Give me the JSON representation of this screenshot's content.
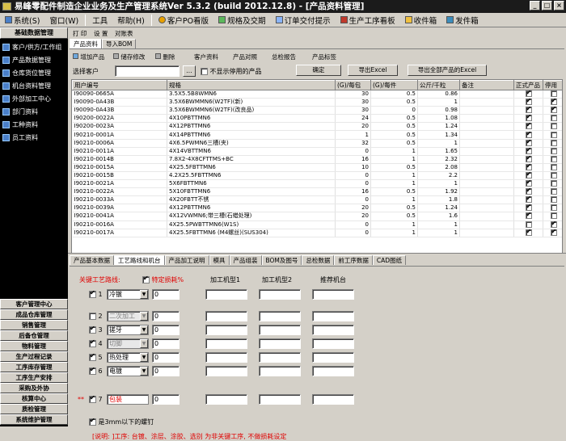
{
  "window": {
    "title": "易峰零配件制造企业业务及生产管理系统Ver 5.3.2  (build 2012.12.8)  - [产品资料管理]"
  },
  "menubar": [
    {
      "label": "系统(S)",
      "icon": "system-icon"
    },
    {
      "label": "窗口(W)",
      "icon": ""
    },
    {
      "label": "工具",
      "icon": ""
    },
    {
      "label": "帮助(H)",
      "icon": ""
    },
    {
      "label": "客户PO看版",
      "icon": "po-board-icon"
    },
    {
      "label": "规格及交期",
      "icon": "spec-icon"
    },
    {
      "label": "订单交付提示",
      "icon": "delivery-icon"
    },
    {
      "label": "生产工序看板",
      "icon": "process-board-icon"
    },
    {
      "label": "收件箱",
      "icon": "inbox-icon"
    },
    {
      "label": "发件箱",
      "icon": "outbox-icon"
    }
  ],
  "sidebar": {
    "header": "基础数据管理",
    "items": [
      "客户/供方/工作组",
      "产品数据管理",
      "仓库货位管理",
      "机台资料管理",
      "外部加工中心",
      "部门资料",
      "工种资料",
      "员工资料"
    ],
    "bottom": [
      "客户管理中心",
      "成品仓库管理",
      "销售管理",
      "后备仓管理",
      "物料管理",
      "生产过程记录",
      "工序库存管理",
      "工序生产安排",
      "采购及外协",
      "核算中心",
      "质检管理",
      "系统维护管理"
    ]
  },
  "toolbar_top": [
    "打 印",
    "设 置",
    "对账表"
  ],
  "tabs_top": [
    "产品资料",
    "导入BOM"
  ],
  "actions": [
    "增加产品",
    "储存修改",
    "删除",
    "客户资料",
    "产品对照",
    "总检报告",
    "产品标签"
  ],
  "filter": {
    "label": "选择客户",
    "value": "",
    "browse": "...",
    "hide_disabled_label": "不显示停用的产品",
    "confirm": "确定",
    "export": "导出Excel",
    "export_all": "导出全部产品的Excel"
  },
  "grid": {
    "columns": [
      "用户编号",
      "规格",
      "(G)/每包",
      "(G)/每件",
      "公斤/千粒",
      "备注",
      "正式产品",
      "停用"
    ],
    "rows": [
      [
        "I90090-0665A",
        "3.5X5.5B8WMN6",
        "30",
        "0.5",
        "0.86",
        "",
        true,
        false
      ],
      [
        "I90090-0A43B",
        "3.5X6BWMMN6(W2TF)(新)",
        "30",
        "0.5",
        "1",
        "",
        true,
        true
      ],
      [
        "I90090-0A43B",
        "3.5X6BWMMN6(W2TF)(改良品)",
        "30",
        "0",
        "0.98",
        "",
        true,
        true
      ],
      [
        "I90200-0022A",
        "4X10PBTTMN6",
        "24",
        "0.5",
        "1.08",
        "",
        true,
        false
      ],
      [
        "I90200-0023A",
        "4X12PBTTMN6",
        "20",
        "0.5",
        "1.24",
        "",
        true,
        false
      ],
      [
        "I90210-0001A",
        "4X14PBTTMN6",
        "1",
        "0.5",
        "1.34",
        "",
        true,
        false
      ],
      [
        "I90210-0006A",
        "4X6.5PWMN6三槽(夹)",
        "32",
        "0.5",
        "1",
        "",
        true,
        false
      ],
      [
        "I90210-0011A",
        "4X14VBTTMN6",
        "0",
        "1",
        "1.65",
        "",
        true,
        false
      ],
      [
        "I90210-0014B",
        "7.8X2-4X8CFTTMS+BC",
        "16",
        "1",
        "2.32",
        "",
        true,
        false
      ],
      [
        "I90210-0015A",
        "4X25.5FBTTMN6",
        "10",
        "0.5",
        "2.08",
        "",
        true,
        false
      ],
      [
        "I90210-0015B",
        "4.2X25.5FBTTMN6",
        "0",
        "1",
        "2.2",
        "",
        true,
        false
      ],
      [
        "I90210-0021A",
        "5X6FBTTMN6",
        "0",
        "1",
        "1",
        "",
        true,
        false
      ],
      [
        "I90210-0022A",
        "5X10FBTTMN6",
        "16",
        "0.5",
        "1.92",
        "",
        true,
        false
      ],
      [
        "I90210-0033A",
        "4X20FBTT不锈",
        "0",
        "1",
        "1.8",
        "",
        true,
        false
      ],
      [
        "I90210-0039A",
        "4X12PBTTMN6",
        "20",
        "0.5",
        "1.24",
        "",
        true,
        false
      ],
      [
        "I90210-0041A",
        "4X12VWMN6;带三槽(石蜡处理)",
        "20",
        "0.5",
        "1.6",
        "",
        true,
        false
      ],
      [
        "I90210-0016A",
        "4X25.5PWBTTMN6(W1S)",
        "0",
        "1",
        "1",
        "",
        false,
        true
      ],
      [
        "I90210-0017A",
        "4X25.5FBTTMN6 (M4螺丝)(SUS304)",
        "0",
        "1",
        "1",
        "",
        true,
        true
      ]
    ]
  },
  "tabs_bottom": [
    "产品基本数据",
    "工艺路线和机台",
    "产品加工说明",
    "模具",
    "产品组装",
    "BOM及图号",
    "总检数据",
    "前工序数据",
    "CAD图纸"
  ],
  "process": {
    "key_label": "关键工艺路线:",
    "loss_label": "特定损耗%",
    "col_machine1": "加工机型1",
    "col_machine2": "加工机型2",
    "col_recommend": "推荐机台",
    "rows": [
      {
        "checked": true,
        "num": "1",
        "name": "冷镦",
        "loss": "0",
        "enabled": true,
        "marker": ""
      },
      {
        "checked": false,
        "num": "2",
        "name": "二次加工",
        "loss": "0",
        "enabled": false,
        "marker": ""
      },
      {
        "checked": true,
        "num": "3",
        "name": "搓牙",
        "loss": "0",
        "enabled": true,
        "marker": ""
      },
      {
        "checked": true,
        "num": "4",
        "name": "切脚",
        "loss": "0",
        "enabled": false,
        "marker": ""
      },
      {
        "checked": true,
        "num": "5",
        "name": "热处理",
        "loss": "0",
        "enabled": true,
        "marker": ""
      },
      {
        "checked": true,
        "num": "6",
        "name": "电镀",
        "loss": "0",
        "enabled": true,
        "marker": ""
      },
      {
        "checked": true,
        "num": "7",
        "name": "包装",
        "loss": "0",
        "enabled": true,
        "marker": "**"
      }
    ],
    "small_screw": "是3mm以下的螺钉",
    "note": "[说明: ]工序: 台镀、涂层、涂胶、选别 为非关键工序, 不做损耗设定"
  }
}
